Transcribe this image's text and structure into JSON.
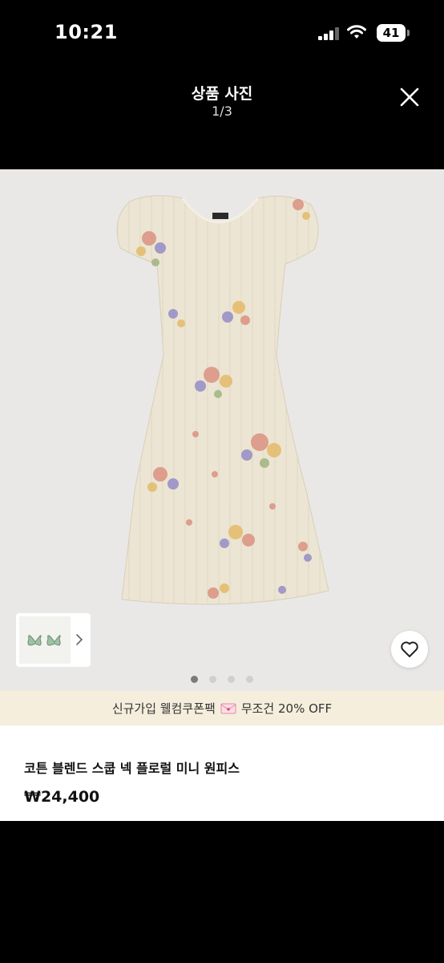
{
  "status_bar": {
    "time": "10:21",
    "battery": "41"
  },
  "header": {
    "title": "상품 사진",
    "counter": "1/3"
  },
  "gallery": {
    "pages": 4,
    "active": 1
  },
  "promo": {
    "prefix": "신규가입 웰컴쿠폰팩",
    "icon": "love-letter-icon",
    "suffix": "무조건 20% OFF"
  },
  "product": {
    "name": "코튼 블렌드 스쿱 넥 플로럴 미니 원피스",
    "price": "₩24,400"
  },
  "colors": {
    "background": "#000000",
    "image_bg": "#e9e8e6",
    "promo_bg": "#f6eedc",
    "dress": "#ece5d3"
  }
}
